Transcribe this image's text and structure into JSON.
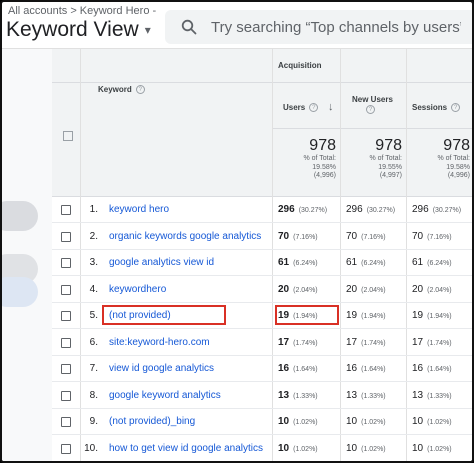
{
  "breadcrumb": {
    "accounts": "All accounts",
    "sep": ">",
    "property": "Keyword Hero -"
  },
  "view": {
    "title": "Keyword View",
    "caret": "▾"
  },
  "search": {
    "placeholder": "Try searching “Top channels by users”"
  },
  "table": {
    "headers": {
      "keyword": "Keyword",
      "group": "Acquisition",
      "users": "Users",
      "new_users": "New Users",
      "sessions": "Sessions",
      "help": "?",
      "sort_arrow": "↓"
    },
    "totals": {
      "users": {
        "value": "978",
        "pct_label": "% of Total:",
        "pct": "19.58%",
        "base": "(4,996)"
      },
      "new_users": {
        "value": "978",
        "pct_label": "% of Total:",
        "pct": "19.55%",
        "base": "(4,997)"
      },
      "sessions": {
        "value": "978",
        "pct_label": "% of Total:",
        "pct": "19.58%",
        "base": "(4,996)"
      }
    },
    "rows": [
      {
        "index": "1.",
        "keyword": "keyword hero",
        "users": "296",
        "users_pct": "(30.27%)",
        "new_users": "296",
        "new_users_pct": "(30.27%)",
        "sessions": "296",
        "sessions_pct": "(30.27%)"
      },
      {
        "index": "2.",
        "keyword": "organic keywords google analytics",
        "users": "70",
        "users_pct": "(7.16%)",
        "new_users": "70",
        "new_users_pct": "(7.16%)",
        "sessions": "70",
        "sessions_pct": "(7.16%)"
      },
      {
        "index": "3.",
        "keyword": "google analytics view id",
        "users": "61",
        "users_pct": "(6.24%)",
        "new_users": "61",
        "new_users_pct": "(6.24%)",
        "sessions": "61",
        "sessions_pct": "(6.24%)"
      },
      {
        "index": "4.",
        "keyword": "keywordhero",
        "users": "20",
        "users_pct": "(2.04%)",
        "new_users": "20",
        "new_users_pct": "(2.04%)",
        "sessions": "20",
        "sessions_pct": "(2.04%)"
      },
      {
        "index": "5.",
        "keyword": "(not provided)",
        "users": "19",
        "users_pct": "(1.94%)",
        "new_users": "19",
        "new_users_pct": "(1.94%)",
        "sessions": "19",
        "sessions_pct": "(1.94%)"
      },
      {
        "index": "6.",
        "keyword": "site:keyword-hero.com",
        "users": "17",
        "users_pct": "(1.74%)",
        "new_users": "17",
        "new_users_pct": "(1.74%)",
        "sessions": "17",
        "sessions_pct": "(1.74%)"
      },
      {
        "index": "7.",
        "keyword": "view id google analytics",
        "users": "16",
        "users_pct": "(1.64%)",
        "new_users": "16",
        "new_users_pct": "(1.64%)",
        "sessions": "16",
        "sessions_pct": "(1.64%)"
      },
      {
        "index": "8.",
        "keyword": "google keyword analytics",
        "users": "13",
        "users_pct": "(1.33%)",
        "new_users": "13",
        "new_users_pct": "(1.33%)",
        "sessions": "13",
        "sessions_pct": "(1.33%)"
      },
      {
        "index": "9.",
        "keyword": "(not provided)_bing",
        "users": "10",
        "users_pct": "(1.02%)",
        "new_users": "10",
        "new_users_pct": "(1.02%)",
        "sessions": "10",
        "sessions_pct": "(1.02%)"
      },
      {
        "index": "10.",
        "keyword": "how to get view id google analytics",
        "users": "10",
        "users_pct": "(1.02%)",
        "new_users": "10",
        "new_users_pct": "(1.02%)",
        "sessions": "10",
        "sessions_pct": "(1.02%)"
      }
    ]
  },
  "colors": {
    "link": "#1558d6",
    "highlight": "#d93025",
    "header_bg": "#f1f3f4"
  }
}
